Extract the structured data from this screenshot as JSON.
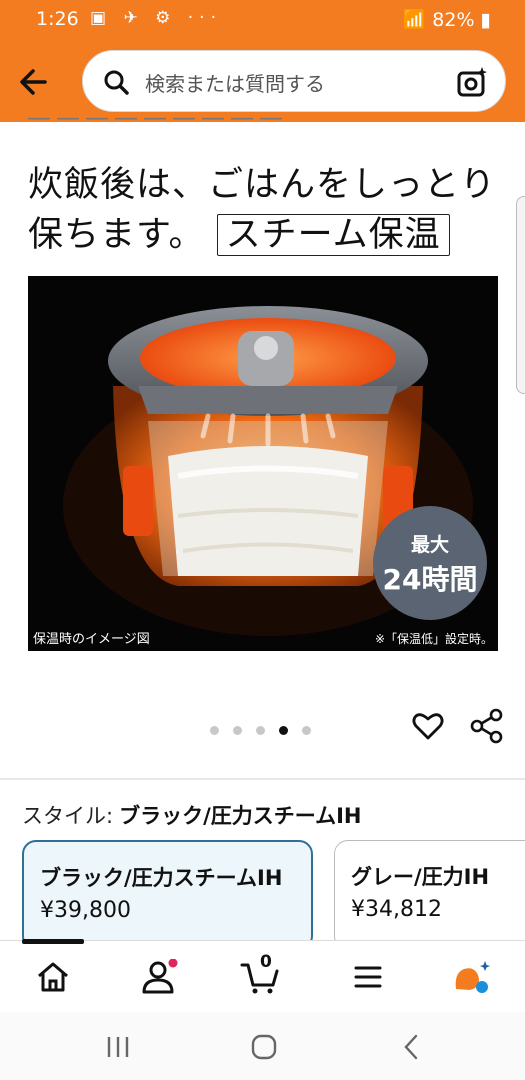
{
  "status_bar": {
    "time": "1:26",
    "battery": "82%",
    "notification_icons": "▣ ✈ ⚙ ···"
  },
  "search": {
    "placeholder": "検索または質問する"
  },
  "cut_off_text": "― ― ― ―  ―  ― ―  ―  ―",
  "headline": {
    "line1": "炊飯後は、ごはんをしっとり",
    "line2": "保ちます。",
    "boxed": "スチーム保温"
  },
  "image": {
    "caption_left": "保温時のイメージ図",
    "caption_right": "※「保温低」設定時。",
    "badge_top": "最大",
    "badge_main": "24時間"
  },
  "carousel": {
    "count": 5,
    "active": 4
  },
  "style": {
    "label": "スタイル:",
    "value": "ブラック/圧力スチームIH"
  },
  "variants": [
    {
      "name": "ブラック/圧力スチームIH",
      "price": "¥39,800",
      "selected": true
    },
    {
      "name": "グレー/圧力IH",
      "price": "¥34,812",
      "selected": false
    }
  ],
  "nav": {
    "cart_count": "0"
  },
  "colors": {
    "header": "#f47c20",
    "selected_border": "#2f6f98",
    "badge": "#5b6473"
  }
}
